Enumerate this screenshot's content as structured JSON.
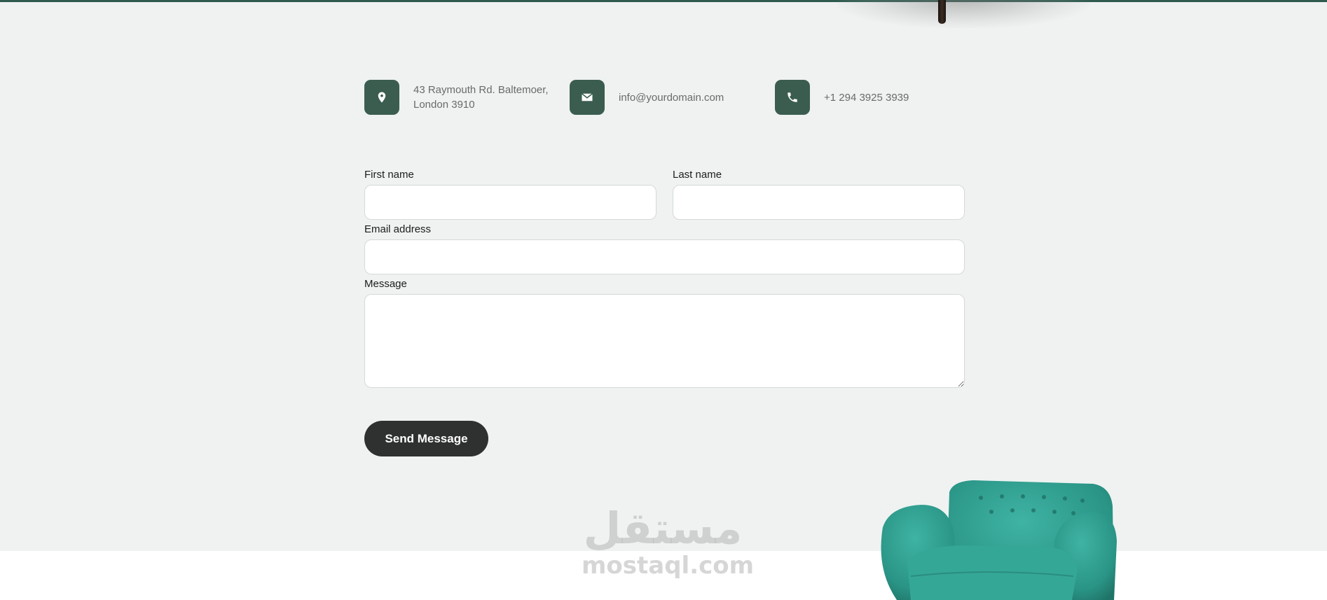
{
  "contact": {
    "address": "43 Raymouth Rd. Baltemoer,\nLondon 3910",
    "email": "info@yourdomain.com",
    "phone": "+1 294 3925 3939",
    "icons": [
      "map-pin-icon",
      "envelope-icon",
      "phone-icon"
    ]
  },
  "form": {
    "first_name_label": "First name",
    "last_name_label": "Last name",
    "email_label": "Email address",
    "message_label": "Message",
    "first_name_value": "",
    "last_name_value": "",
    "email_value": "",
    "message_value": "",
    "submit_label": "Send Message"
  },
  "watermark": {
    "arabic": "مستقل",
    "latin": "mostaql.com"
  },
  "colors": {
    "accent": "#3b5d50",
    "section_bg": "#eff2f1",
    "button_bg": "#2f3030",
    "chair": "#2f9e90"
  }
}
